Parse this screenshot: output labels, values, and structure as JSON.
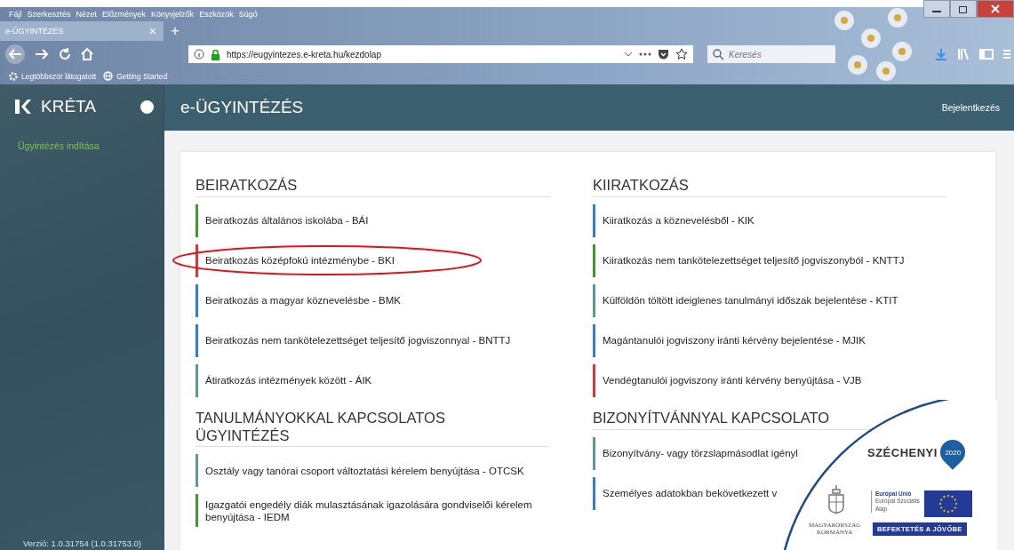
{
  "browser": {
    "menu": [
      "Fájl",
      "Szerkesztés",
      "Nézet",
      "Előzmények",
      "Könyvjelzők",
      "Eszközök",
      "Súgó"
    ],
    "tab": {
      "title": "e-ÜGYINTÉZÉS",
      "close": "×"
    },
    "new_tab": "+",
    "url": "https://eugyintezes.e-kreta.hu/kezdolap",
    "search": {
      "placeholder": "Keresés"
    },
    "bookmarks": [
      "Legtöbbször látogatott",
      "Getting Started"
    ]
  },
  "sidebar": {
    "logo": "KRÉTA",
    "items": [
      {
        "label": "Ügyintézés indítása",
        "selected": true
      }
    ],
    "version": "Verzió: 1.0.31754 (1.0.31753.0)"
  },
  "header": {
    "title": "e-ÜGYINTÉZÉS",
    "login": "Bejelentkezés"
  },
  "columns": [
    [
      {
        "title": "BEIRATKOZÁS",
        "items": [
          {
            "label": "Beiratkozás általános iskolába - BÁI",
            "color": "#3f9a2e",
            "circled": false
          },
          {
            "label": "Beiratkozás középfokú intézménybe - BKI",
            "color": "#d9363e",
            "circled": true
          },
          {
            "label": "Beiratkozás a magyar köznevelésbe - BMK",
            "color": "#2f7fd8",
            "circled": false
          },
          {
            "label": "Beiratkozás nem tankötelezettséget teljesítő jogviszonnyal - BNTTJ",
            "color": "#2f7fd8",
            "circled": false
          },
          {
            "label": "Átiratkozás intézmények között - ÁIK",
            "color": "#5b9a92",
            "circled": false
          }
        ]
      },
      {
        "title": "TANULMÁNYOKKAL KAPCSOLATOS ÜGYINTÉZÉS",
        "items": [
          {
            "label": "Osztály vagy tanórai csoport változtatási kérelem benyújtása - OTCSK",
            "color": "#5b9a92",
            "circled": false
          },
          {
            "label": "Igazgatói engedély diák mulasztásának igazolására gondviselői kérelem benyújtása - IEDM",
            "color": "#3f9a2e",
            "circled": false
          }
        ]
      }
    ],
    [
      {
        "title": "KIIRATKOZÁS",
        "items": [
          {
            "label": "Kiiratkozás a köznevelésből - KIK",
            "color": "#2f7fd8",
            "circled": false
          },
          {
            "label": "Kiiratkozás nem tankötelezettséget teljesítő jogviszonyból - KNTTJ",
            "color": "#3f9a2e",
            "circled": false
          },
          {
            "label": "Külföldön töltött ideiglenes tanulmányi időszak bejelentése - KTIT",
            "color": "#5b9a92",
            "circled": false
          },
          {
            "label": "Magántanulói jogviszony iránti kérvény bejelentése - MJIK",
            "color": "#2f7fd8",
            "circled": false
          },
          {
            "label": "Vendégtanulói jogviszony iránti kérvény benyújtása - VJB",
            "color": "#d9363e",
            "circled": false
          }
        ]
      },
      {
        "title": "BIZONYÍTVÁNNYAL KAPCSOLATO",
        "items": [
          {
            "label": "Bizonyítvány- vagy törzslapmásodlat igényl",
            "color": "#5b9a92",
            "circled": false
          },
          {
            "label": "Személyes adatokban bekövetkezett v",
            "color": "#2f7fd8",
            "circled": false
          }
        ]
      }
    ]
  ],
  "badge": {
    "title": "SZÉCHENYI",
    "year": "2020",
    "government": [
      "MAGYARORSZÁG",
      "KORMÁNYA"
    ],
    "eu": [
      "Európai Unió",
      "Európai Szociális",
      "Alap"
    ],
    "slogan": "BEFEKTETÉS A JÖVŐBE"
  }
}
